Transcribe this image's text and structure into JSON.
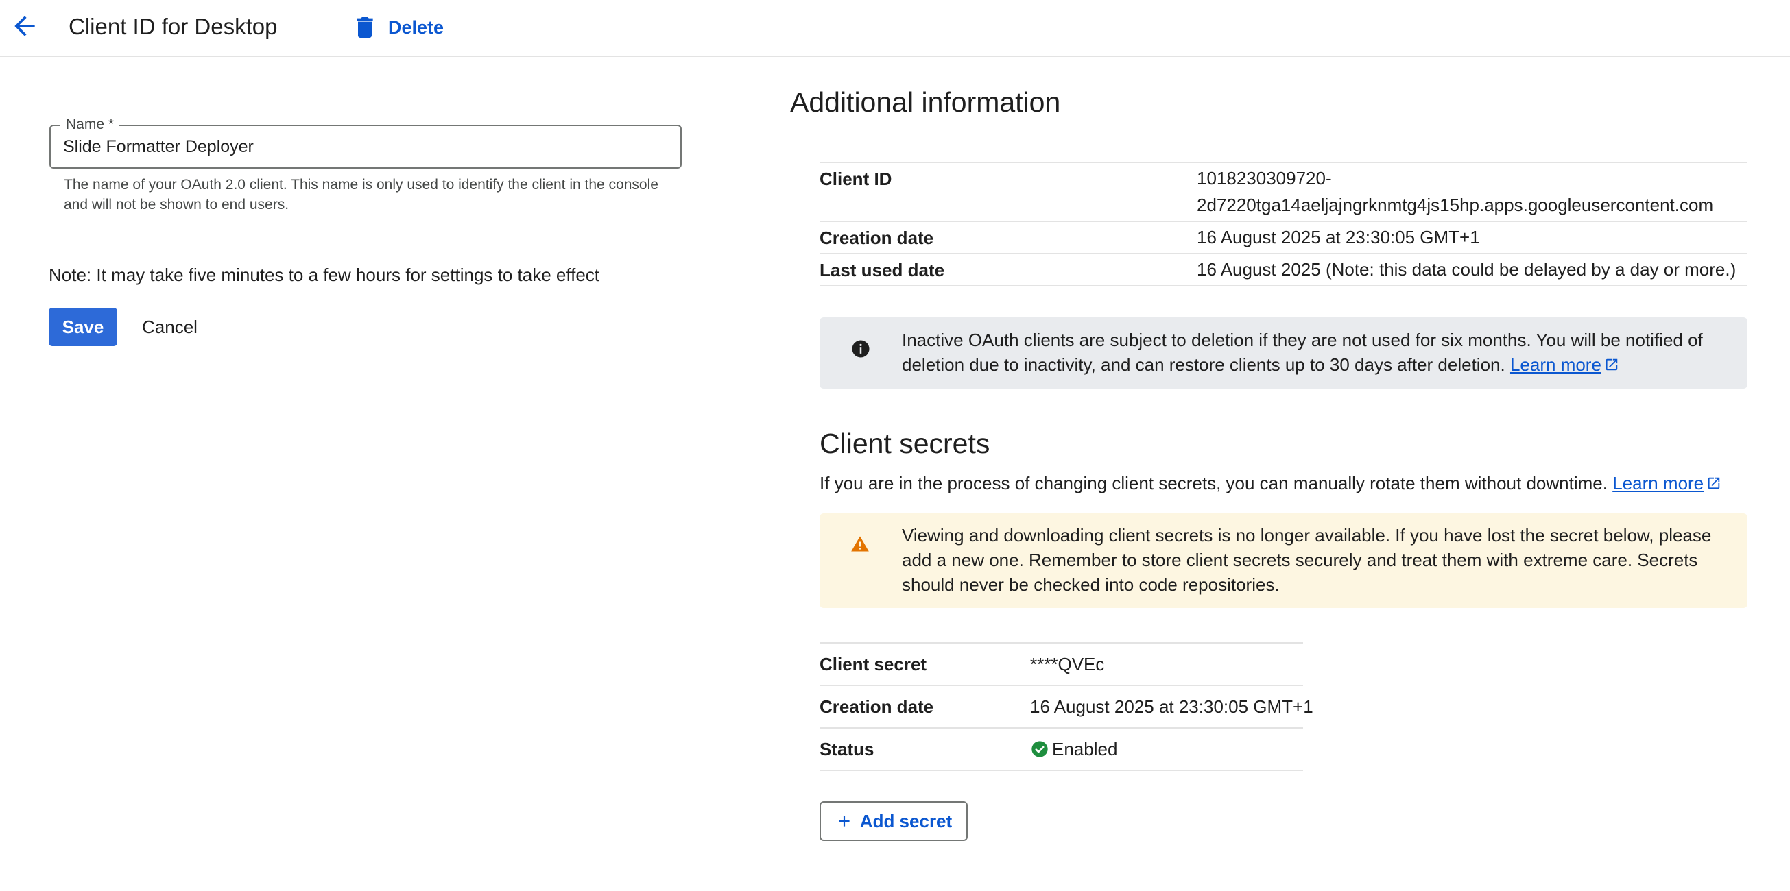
{
  "header": {
    "title": "Client ID for Desktop",
    "delete_label": "Delete",
    "back_icon": "arrow-back-icon",
    "delete_icon": "trash-icon",
    "accent_color": "#0b57d0"
  },
  "form": {
    "name_label": "Name *",
    "name_value": "Slide Formatter Deployer",
    "name_help": "The name of your OAuth 2.0 client. This name is only used to identify the client in the console and will not be shown to end users.",
    "note": "Note: It may take five minutes to a few hours for settings to take effect",
    "save_label": "Save",
    "cancel_label": "Cancel",
    "save_color": "#2d6ad8"
  },
  "additional_info": {
    "title": "Additional information",
    "rows": [
      {
        "label": "Client ID",
        "value": "1018230309720-\n2d7220tga14aeljajngrknmtg4js15hp.apps.googleusercontent.com"
      },
      {
        "label": "Creation date",
        "value": "16 August 2025 at 23:30:05 GMT+1"
      },
      {
        "label": "Last used date",
        "value": "16 August 2025 (Note: this data could be delayed by a day or more.)"
      }
    ],
    "info_banner": {
      "icon": "info-icon",
      "text": "Inactive OAuth clients are subject to deletion if they are not used for six months. You will be notified of deletion due to inactivity, and can restore clients up to 30 days after deletion.",
      "link": "Learn more"
    }
  },
  "client_secrets": {
    "title": "Client secrets",
    "description": "If you are in the process of changing client secrets, you can manually rotate them without downtime.",
    "description_link": "Learn more",
    "warning_banner": {
      "icon": "warning-icon",
      "text": "Viewing and downloading client secrets is no longer available. If you have lost the secret below, please add a new one. Remember to store client secrets securely and treat them with extreme care. Secrets should never be checked into code repositories."
    },
    "rows": [
      {
        "label": "Client secret",
        "value": "****QVEc"
      },
      {
        "label": "Creation date",
        "value": "16 August 2025 at 23:30:05 GMT+1"
      },
      {
        "label": "Status",
        "value": "Enabled",
        "icon": "check-circle-icon",
        "status_color": "#1e8e3e"
      }
    ],
    "add_label": "Add secret",
    "add_icon": "plus-icon"
  }
}
